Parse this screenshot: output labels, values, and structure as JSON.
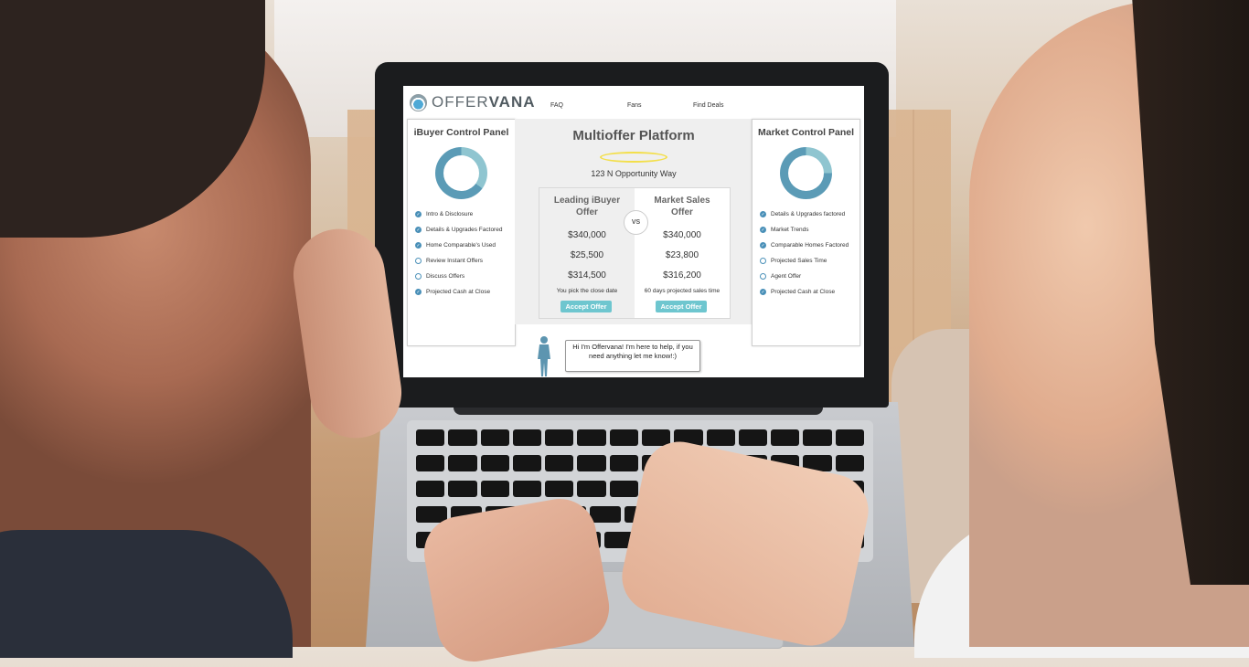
{
  "brand": {
    "name_light": "OFFER",
    "name_bold": "VANA"
  },
  "nav": {
    "faq": "FAQ",
    "fans": "Fans",
    "find_deals": "Find Deals"
  },
  "left_panel": {
    "title": "iBuyer Control Panel",
    "progress_fraction": 0.65,
    "items": [
      {
        "label": "Intro & Disclosure",
        "checked": true
      },
      {
        "label": "Details & Upgrades Factored",
        "checked": true
      },
      {
        "label": "Home Comparable's Used",
        "checked": true
      },
      {
        "label": "Review Instant Offers",
        "checked": false
      },
      {
        "label": "Discuss Offers",
        "checked": false
      },
      {
        "label": "Projected Cash at Close",
        "checked": true
      }
    ]
  },
  "right_panel": {
    "title": "Market Control Panel",
    "progress_fraction": 0.75,
    "items": [
      {
        "label": "Details & Upgrades factored",
        "checked": true
      },
      {
        "label": "Market Trends",
        "checked": true
      },
      {
        "label": "Comparable Homes Factored",
        "checked": true
      },
      {
        "label": "Projected Sales Time",
        "checked": false
      },
      {
        "label": "Agent Offer",
        "checked": false
      },
      {
        "label": "Projected Cash at Close",
        "checked": true
      }
    ]
  },
  "platform": {
    "title": "Multioffer Platform",
    "address": "123 N Opportunity Way",
    "vs_label": "VS",
    "ibuyer": {
      "heading_1": "Leading iBuyer",
      "heading_2": "Offer",
      "price": "$340,000",
      "fees": "$25,500",
      "net": "$314,500",
      "note": "You pick the close date",
      "button": "Accept Offer"
    },
    "market": {
      "heading_1": "Market Sales",
      "heading_2": "Offer",
      "price": "$340,000",
      "fees": "$23,800",
      "net": "$316,200",
      "note": "60 days projected sales time",
      "button": "Accept Offer"
    }
  },
  "assistant": {
    "message": "Hi I'm Offervana! I'm here to help, if you need anything let me know!:)"
  },
  "colors": {
    "accent": "#6ec6cf",
    "check": "#4a90b8",
    "donut_light": "#8fc5d0",
    "donut_dark": "#5b9bb6",
    "halo": "#f3df4a"
  }
}
